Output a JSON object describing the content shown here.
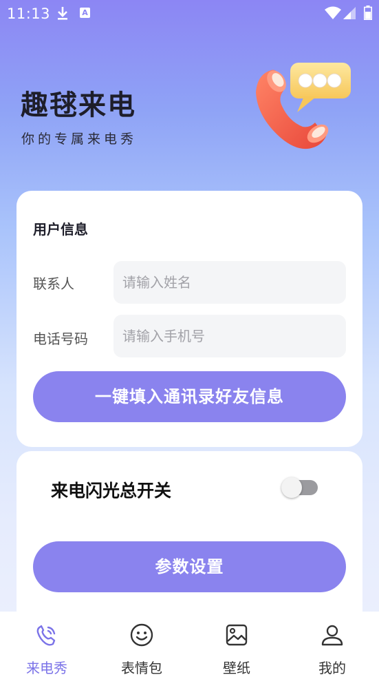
{
  "status_bar": {
    "time": "11:13"
  },
  "header": {
    "title": "趣毬来电",
    "subtitle": "你的专属来电秀",
    "illustration_icon": "phone-chat-bubble-icon"
  },
  "user_card": {
    "title": "用户信息",
    "contact_label": "联系人",
    "contact_placeholder": "请输入姓名",
    "phone_label": "电话号码",
    "phone_placeholder": "请输入手机号",
    "fill_button": "一键填入通讯录好友信息"
  },
  "flash_card": {
    "switch_label": "来电闪光总开关",
    "switch_on": false,
    "settings_button": "参数设置"
  },
  "bottom_nav": {
    "items": [
      {
        "label": "来电秀",
        "icon": "phone-icon",
        "active": true
      },
      {
        "label": "表情包",
        "icon": "smiley-icon",
        "active": false
      },
      {
        "label": "壁纸",
        "icon": "image-icon",
        "active": false
      },
      {
        "label": "我的",
        "icon": "user-icon",
        "active": false
      }
    ]
  },
  "colors": {
    "accent": "#8a83ee",
    "active_nav": "#7b73e8"
  }
}
